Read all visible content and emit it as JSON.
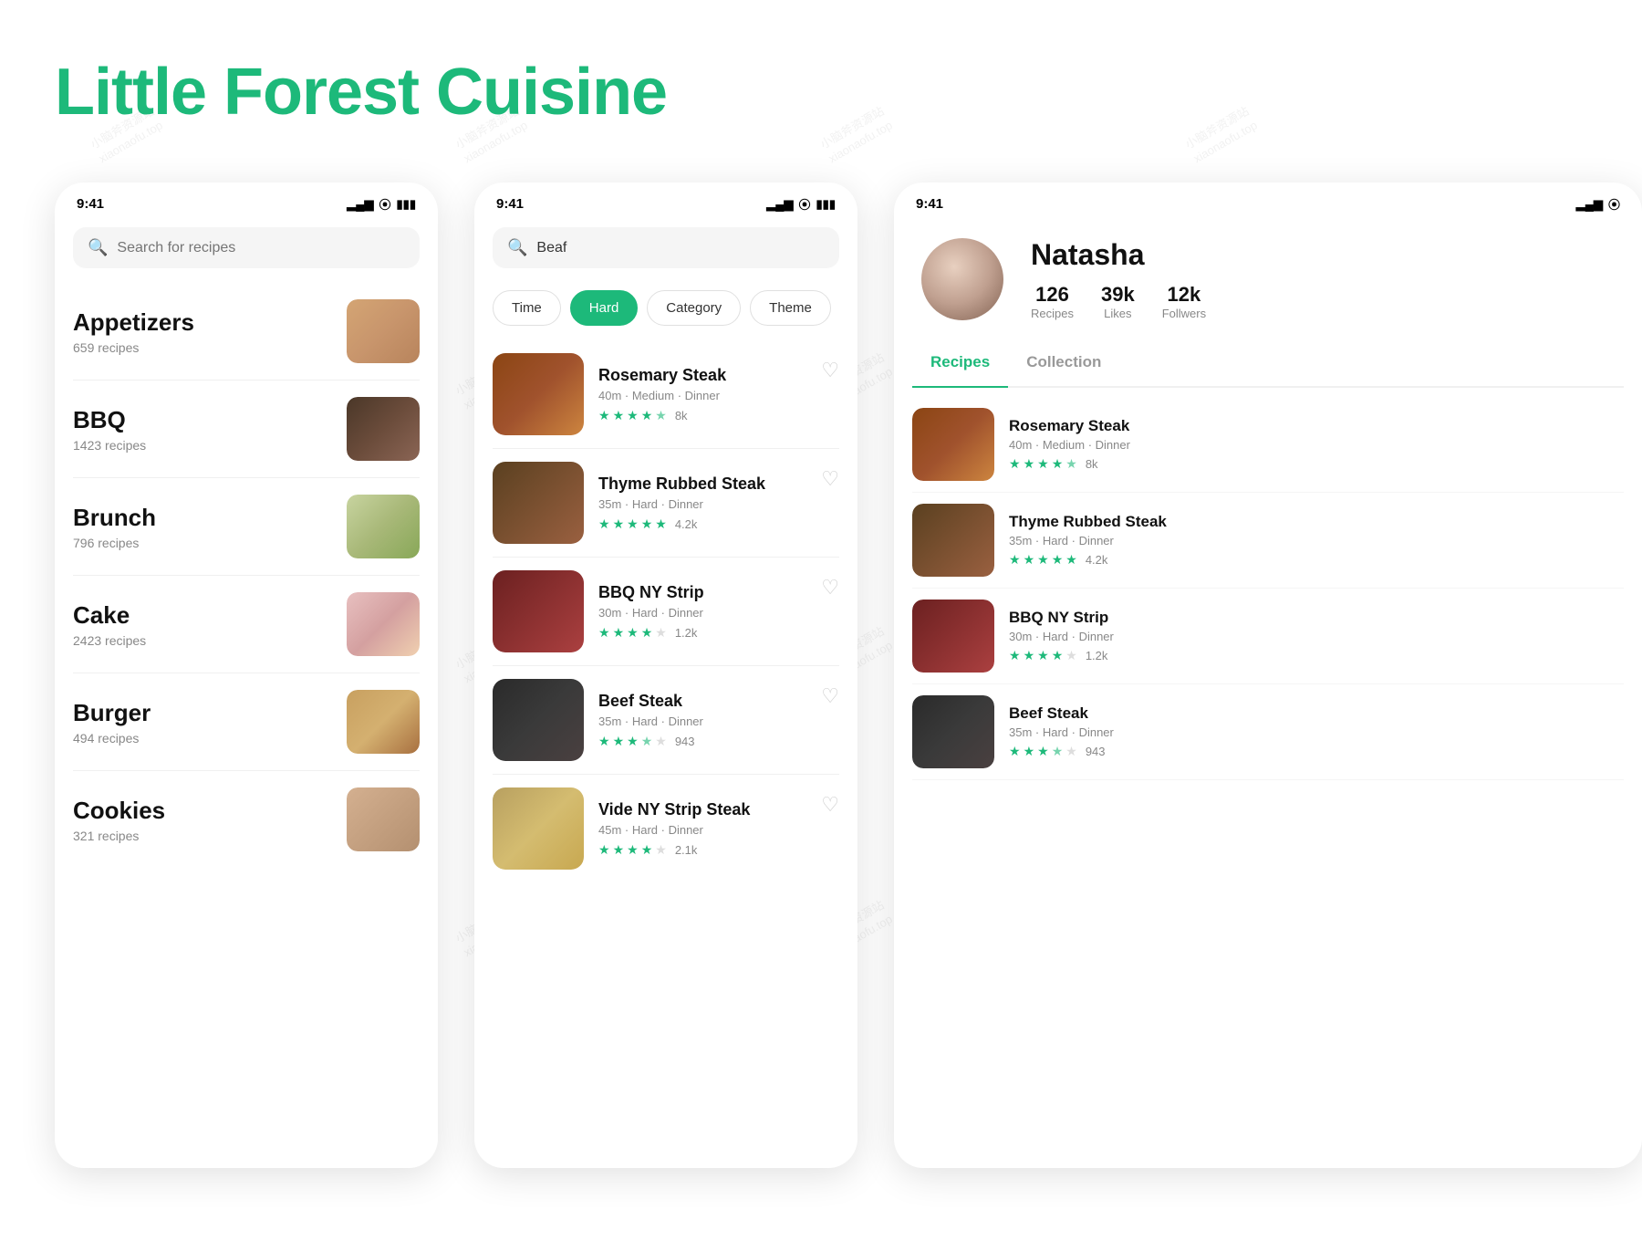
{
  "app": {
    "title": "Little Forest Cuisine",
    "brand_color": "#1db97a"
  },
  "screen1": {
    "status_time": "9:41",
    "search_placeholder": "Search for recipes",
    "categories": [
      {
        "name": "Appetizers",
        "count": "659 recipes",
        "img_class": "img-appetizer"
      },
      {
        "name": "BBQ",
        "count": "1423 recipes",
        "img_class": "img-bbq"
      },
      {
        "name": "Brunch",
        "count": "796 recipes",
        "img_class": "img-brunch"
      },
      {
        "name": "Cake",
        "count": "2423 recipes",
        "img_class": "img-cake"
      },
      {
        "name": "Burger",
        "count": "494 recipes",
        "img_class": "img-burger"
      },
      {
        "name": "Cookies",
        "count": "321 recipes",
        "img_class": "img-cookies"
      }
    ]
  },
  "screen2": {
    "status_time": "9:41",
    "search_value": "Beaf",
    "filters": [
      {
        "label": "Time",
        "active": false
      },
      {
        "label": "Hard",
        "active": true
      },
      {
        "label": "Category",
        "active": false
      },
      {
        "label": "Theme",
        "active": false
      }
    ],
    "recipes": [
      {
        "name": "Rosemary Steak",
        "meta": "40m · Medium · Dinner",
        "stars": 4,
        "half_star": true,
        "rating": "8k",
        "img_class": "img-steak1",
        "liked": false
      },
      {
        "name": "Thyme Rubbed Steak",
        "meta": "35m · Hard · Dinner",
        "stars": 5,
        "half_star": false,
        "rating": "4.2k",
        "img_class": "img-steak2",
        "liked": false
      },
      {
        "name": "BBQ NY Strip",
        "meta": "30m · Hard · Dinner",
        "stars": 4,
        "half_star": false,
        "rating": "1.2k",
        "img_class": "img-bbqstrip",
        "liked": false
      },
      {
        "name": "Beef Steak",
        "meta": "35m · Hard · Dinner",
        "stars": 3,
        "half_star": true,
        "rating": "943",
        "img_class": "img-beefsteak",
        "liked": false
      },
      {
        "name": "Vide NY Strip Steak",
        "meta": "45m · Hard · Dinner",
        "stars": 4,
        "half_star": false,
        "rating": "2.1k",
        "img_class": "img-vide",
        "liked": false
      }
    ]
  },
  "screen3": {
    "status_time": "9:41",
    "user": {
      "name": "Natasha",
      "recipes_count": "126",
      "recipes_label": "Recipes",
      "likes_count": "39k",
      "likes_label": "Likes",
      "followers_count": "12k",
      "followers_label": "Follwers"
    },
    "tabs": [
      {
        "label": "Recipes",
        "active": true
      },
      {
        "label": "Collection",
        "active": false
      }
    ],
    "recipes": [
      {
        "name": "Rosemary Steak",
        "meta": "40m · Medium · Dinner",
        "stars": 4,
        "half_star": true,
        "rating": "8k",
        "img_class": "img-steak1"
      },
      {
        "name": "Thyme Rubbed Steak",
        "meta": "35m · Hard · Dinner",
        "stars": 5,
        "half_star": false,
        "rating": "4.2k",
        "img_class": "img-steak2"
      },
      {
        "name": "BBQ NY Strip",
        "meta": "30m · Hard · Dinner",
        "stars": 4,
        "half_star": false,
        "rating": "1.2k",
        "img_class": "img-bbqstrip"
      },
      {
        "name": "Beef Steak",
        "meta": "35m · Hard · Dinner",
        "stars": 3,
        "half_star": true,
        "rating": "943",
        "img_class": "img-beefsteak"
      }
    ]
  },
  "watermarks": [
    "小脑斧资源站\nxiaonaofu.top",
    "小脑斧资源站\nxiaonaofu.top",
    "小脑斧资源站\nxiaonaofu.top",
    "小脑斧资源站\nxiaonaofu.top"
  ]
}
